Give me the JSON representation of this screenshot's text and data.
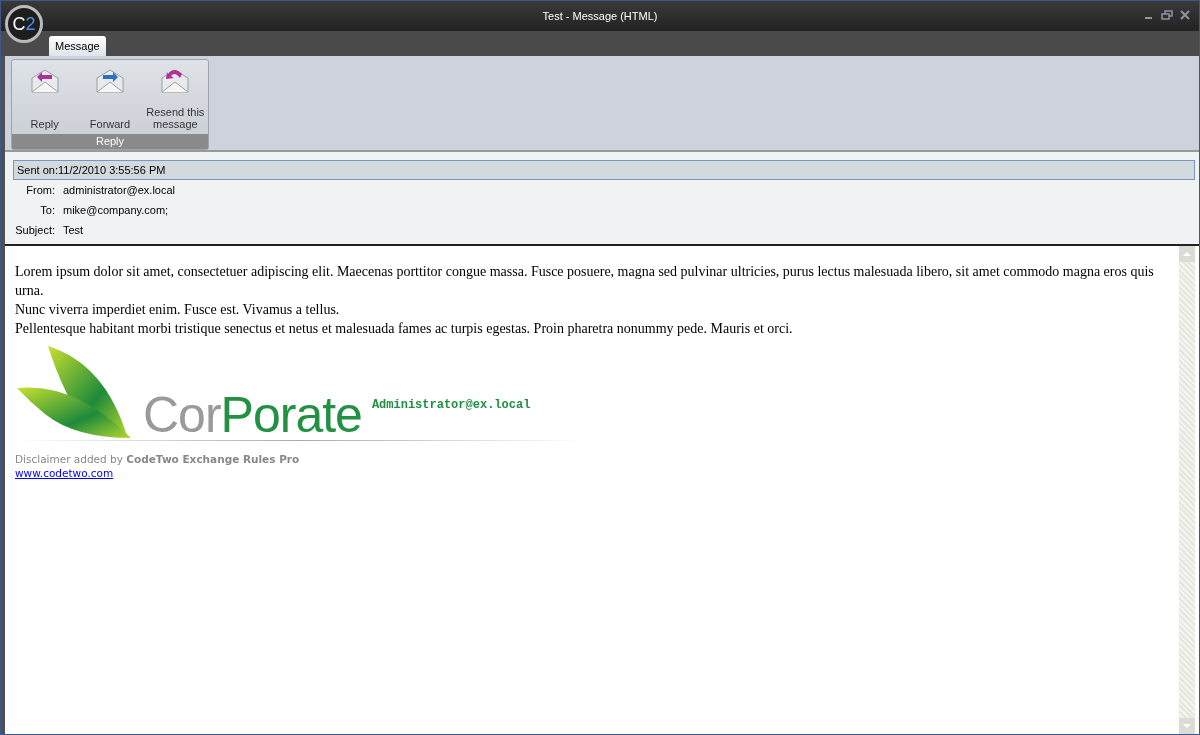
{
  "window": {
    "title": "Test - Message (HTML)",
    "logo": {
      "letter": "C",
      "digit": "2"
    }
  },
  "tabs": [
    {
      "label": "Message",
      "selected": true
    }
  ],
  "ribbon": {
    "groups": [
      {
        "label": "Reply",
        "buttons": [
          {
            "label": "Reply",
            "kind": "reply"
          },
          {
            "label": "Forward",
            "kind": "forward"
          },
          {
            "label": "Resend this message",
            "kind": "resend"
          }
        ]
      }
    ]
  },
  "header": {
    "sent_on": "Sent on:11/2/2010 3:55:56 PM",
    "fields": [
      {
        "label": "From:",
        "value": "administrator@ex.local"
      },
      {
        "label": "To:",
        "value": "mike@company.com;"
      },
      {
        "label": "Subject:",
        "value": "Test"
      }
    ]
  },
  "body": {
    "paragraphs": [
      "Lorem ipsum dolor sit amet, consectetuer adipiscing elit. Maecenas porttitor congue massa. Fusce posuere, magna sed pulvinar ultricies, purus lectus malesuada libero, sit amet commodo magna eros quis urna.",
      "Nunc viverra imperdiet enim. Fusce est. Vivamus a tellus.",
      "Pellentesque habitant morbi tristique senectus et netus et malesuada fames ac turpis egestas. Proin pharetra nonummy pede. Mauris et orci."
    ],
    "signature": {
      "logo_grey": "Cor",
      "logo_green": "Porate",
      "email": "Administrator@ex.local",
      "disclaimer": "Disclaimer added by **CodeTwo Exchange Rules Pro**",
      "link": "www.codetwo.com"
    }
  }
}
